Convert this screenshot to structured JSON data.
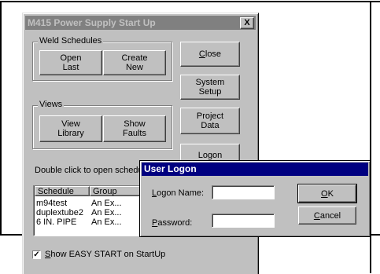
{
  "main_window": {
    "title": "M415 Power Supply Start Up",
    "close_glyph": "X"
  },
  "weld_schedules": {
    "label": "Weld Schedules",
    "open_last": "Open\nLast",
    "create_new": "Create\nNew"
  },
  "views": {
    "label": "Views",
    "view_library": "View\nLibrary",
    "show_faults": "Show\nFaults"
  },
  "side_buttons": {
    "close": "Close",
    "system_setup": "System\nSetup",
    "project_data": "Project\nData",
    "logon": "Logon"
  },
  "instruction": "Double click to open schedu",
  "schedule_list": {
    "columns": [
      "Schedule",
      "Group"
    ],
    "rows": [
      {
        "schedule": "m94test",
        "group": "An Ex..."
      },
      {
        "schedule": "duplextube2",
        "group": "An Ex..."
      },
      {
        "schedule": "6 IN. PIPE",
        "group": "An Ex..."
      }
    ]
  },
  "easy_start": {
    "label_prefix": "S",
    "label_rest": "how EASY START on StartUp",
    "checked": true,
    "check_glyph": "✓"
  },
  "logon_dialog": {
    "title": "User Logon",
    "logon_name_label": "Logon Name:",
    "logon_name_value": "",
    "password_label": "Password:",
    "password_value": "",
    "ok": "OK",
    "cancel": "Cancel"
  }
}
